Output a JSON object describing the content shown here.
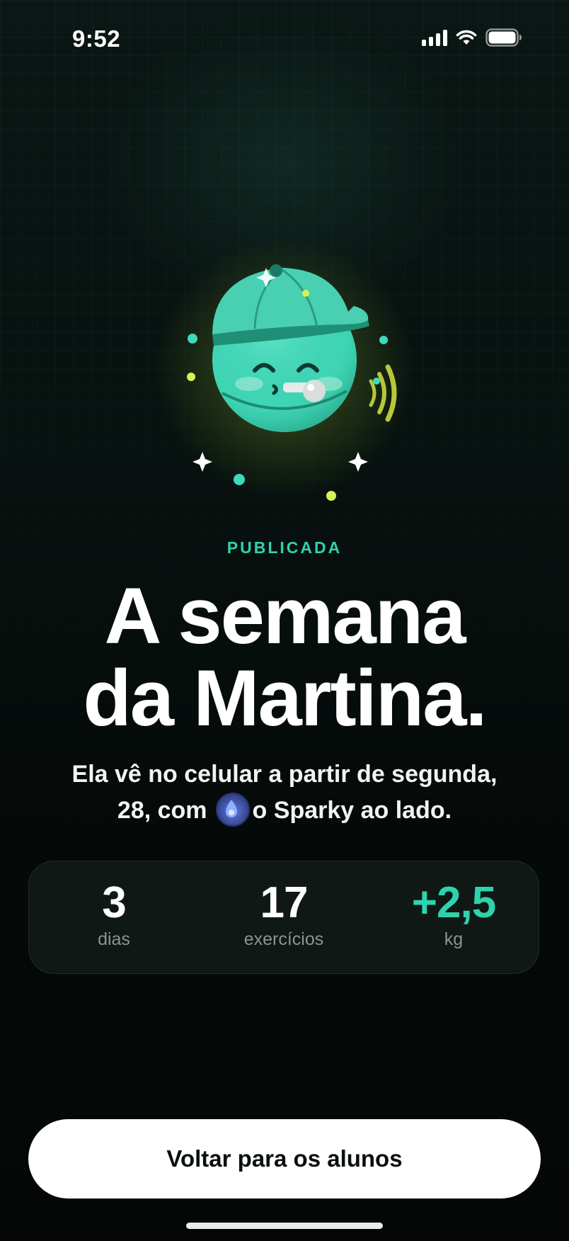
{
  "status_bar": {
    "time": "9:52",
    "icons": [
      "cellular-signal-icon",
      "wifi-icon",
      "battery-icon"
    ]
  },
  "mascot": {
    "icon": "sparky-mascot-whistle-cap",
    "colors": {
      "body": "#3fd8b8",
      "glow": "#c8dc3c"
    }
  },
  "hero": {
    "eyebrow": "PUBLICADA",
    "headline_line1": "A semana",
    "headline_line2": "da Martina.",
    "subtitle_line1": "Ela vê no celular a partir de segunda,",
    "subtitle_line2_prefix": "28, com",
    "subtitle_line2_suffix": "o Sparky ao lado."
  },
  "stats": [
    {
      "value": "3",
      "label": "dias"
    },
    {
      "value": "17",
      "label": "exercícios"
    },
    {
      "value": "+2,5",
      "label": "kg",
      "accent": true
    }
  ],
  "actions": {
    "back_label": "Voltar para os alunos"
  },
  "colors": {
    "accent": "#2ed3ae",
    "background": "#07100e",
    "card": "#0f1815",
    "button": "#ffffff"
  }
}
